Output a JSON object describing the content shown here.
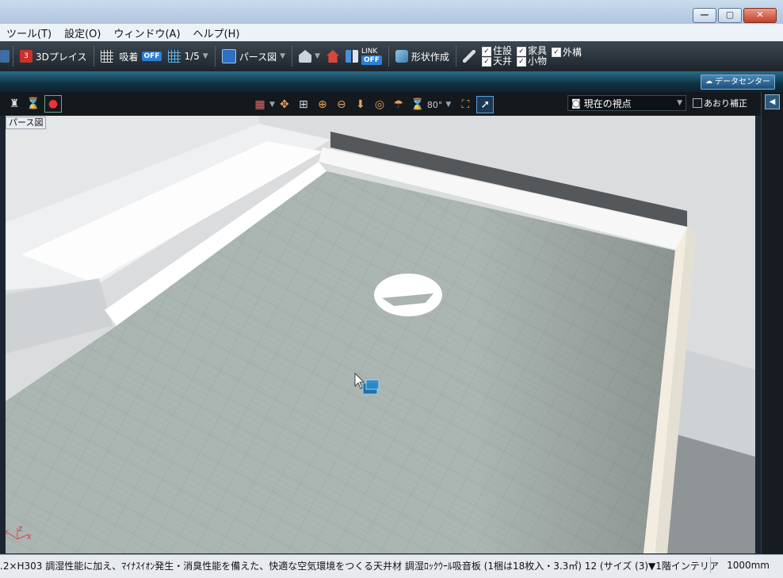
{
  "window": {
    "min_label": "—",
    "max_label": "▢",
    "close_label": "✕"
  },
  "menu": [
    {
      "label": "ツール(T)"
    },
    {
      "label": "設定(O)"
    },
    {
      "label": "ウィンドウ(A)"
    },
    {
      "label": "ヘルプ(H)"
    }
  ],
  "toolbar": {
    "place3d_label": "3Dプレイス",
    "snap_label": "吸着",
    "snap_state": "OFF",
    "grid_scale": "1/5",
    "view_mode": "パース図",
    "link_label": "LINK",
    "link_state": "OFF",
    "shape_label": "形状作成",
    "checks": [
      {
        "label": "住設",
        "checked": true
      },
      {
        "label": "家具",
        "checked": true
      },
      {
        "label": "外構",
        "checked": true
      },
      {
        "label": "天井",
        "checked": true
      },
      {
        "label": "小物",
        "checked": true
      }
    ]
  },
  "datacenter_label": "データセンター",
  "viewbar": {
    "fov": "80°",
    "viewpoint": "現在の視点",
    "tilt_label": "あおり補正"
  },
  "viewport": {
    "label": "パース図"
  },
  "status": {
    "text": ".2×H303  調湿性能に加え、ﾏｲﾅｽｲｵﾝ発生・消臭性能を備えた、快適な空気環境をつくる天井材 調湿ﾛｯｸｳｰﾙ吸音板 (1梱は18枚入・3.3㎡) 12 (サイズ (3)▼1階インテリア",
    "scale": "1000mm"
  },
  "colors": {
    "accent": "#2e7fd3",
    "toolbar_bg": "#1e252c",
    "floor": "#a9b3b0"
  }
}
